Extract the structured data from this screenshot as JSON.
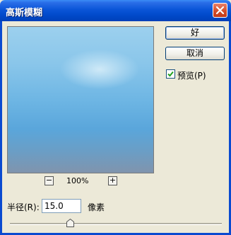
{
  "window": {
    "title": "高斯模糊"
  },
  "buttons": {
    "ok_label": "好",
    "cancel_label": "取消"
  },
  "preview_toggle": {
    "label": "预览(P)",
    "checked": true
  },
  "zoom": {
    "minus": "−",
    "plus": "+",
    "value": "100%"
  },
  "radius": {
    "label": "半径(R):",
    "value": "15.0",
    "unit": "像素"
  },
  "colors": {
    "titlebar": "#0a55d8",
    "background": "#ece9d8"
  },
  "icons": {
    "close": "close-icon",
    "checkbox": "check-icon"
  }
}
